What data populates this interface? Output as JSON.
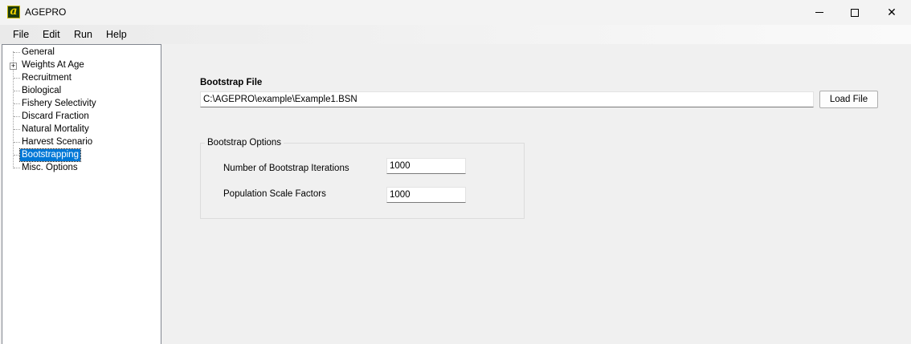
{
  "window": {
    "title": "AGEPRO",
    "icon_letter": "a"
  },
  "menu": {
    "items": [
      "File",
      "Edit",
      "Run",
      "Help"
    ]
  },
  "tree": {
    "items": [
      {
        "label": "General",
        "expandable": false,
        "selected": false
      },
      {
        "label": "Weights At Age",
        "expandable": true,
        "selected": false
      },
      {
        "label": "Recruitment",
        "expandable": false,
        "selected": false
      },
      {
        "label": "Biological",
        "expandable": false,
        "selected": false
      },
      {
        "label": "Fishery Selectivity",
        "expandable": false,
        "selected": false
      },
      {
        "label": "Discard Fraction",
        "expandable": false,
        "selected": false
      },
      {
        "label": "Natural Mortality",
        "expandable": false,
        "selected": false
      },
      {
        "label": "Harvest Scenario",
        "expandable": false,
        "selected": false
      },
      {
        "label": "Bootstrapping",
        "expandable": false,
        "selected": true
      },
      {
        "label": "Misc. Options",
        "expandable": false,
        "selected": false
      }
    ]
  },
  "bootstrap_file": {
    "label": "Bootstrap File",
    "path": "C:\\AGEPRO\\example\\Example1.BSN",
    "load_button": "Load File"
  },
  "bootstrap_options": {
    "title": "Bootstrap Options",
    "iterations_label": "Number of Bootstrap Iterations",
    "iterations_value": "1000",
    "scale_label": "Population Scale Factors",
    "scale_value": "1000"
  },
  "colors": {
    "selection": "#0078d7",
    "window_bg": "#f0f0f0"
  }
}
